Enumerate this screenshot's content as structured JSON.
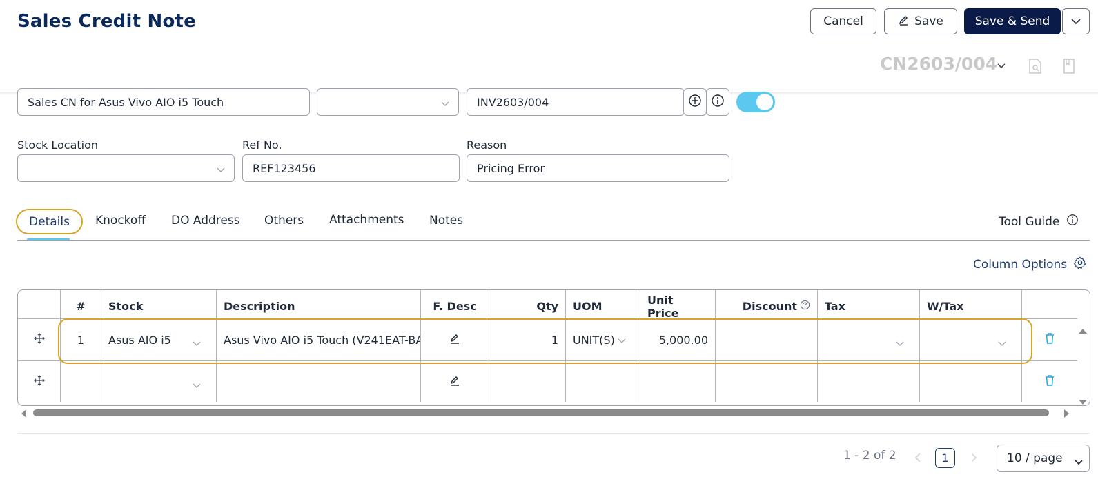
{
  "header": {
    "title": "Sales Credit Note",
    "cancel_label": "Cancel",
    "save_label": "Save",
    "save_send_label": "Save & Send",
    "doc_number": "CN2603/004"
  },
  "form": {
    "description_value": "Sales CN for Asus Vivo AIO i5 Touch",
    "dropdown1_value": "",
    "invoice_value": "INV2603/004",
    "stock_location_label": "Stock Location",
    "stock_location_value": "",
    "ref_no_label": "Ref No.",
    "ref_no_value": "REF123456",
    "reason_label": "Reason",
    "reason_value": "Pricing Error",
    "toggle_on": true
  },
  "tabs": [
    {
      "label": "Details",
      "active": true
    },
    {
      "label": "Knockoff"
    },
    {
      "label": "DO Address"
    },
    {
      "label": "Others"
    },
    {
      "label": "Attachments"
    },
    {
      "label": "Notes"
    }
  ],
  "tool_guide_label": "Tool Guide",
  "column_options_label": "Column Options",
  "table": {
    "headers": [
      "#",
      "Stock",
      "Description",
      "F. Desc",
      "Qty",
      "UOM",
      "Unit Price",
      "Discount",
      "Tax",
      "W/Tax"
    ],
    "rows": [
      {
        "no": "1",
        "stock": "Asus AIO i5",
        "description": "Asus Vivo AIO i5 Touch (V241EAT-BA",
        "qty": "1",
        "uom": "UNIT(S)",
        "unit_price": "5,000.00",
        "discount": "",
        "tax": "",
        "wtax": ""
      },
      {
        "no": "",
        "stock": "",
        "description": "",
        "qty": "",
        "uom": "",
        "unit_price": "",
        "discount": "",
        "tax": "",
        "wtax": ""
      }
    ]
  },
  "pagination": {
    "range_text": "1 - 2 of 2",
    "current_page": "1",
    "page_size": "10 / page"
  },
  "colors": {
    "brand_navy": "#0a1b4a",
    "highlight": "#d6a528",
    "accent_cyan": "#5bc8f0"
  }
}
